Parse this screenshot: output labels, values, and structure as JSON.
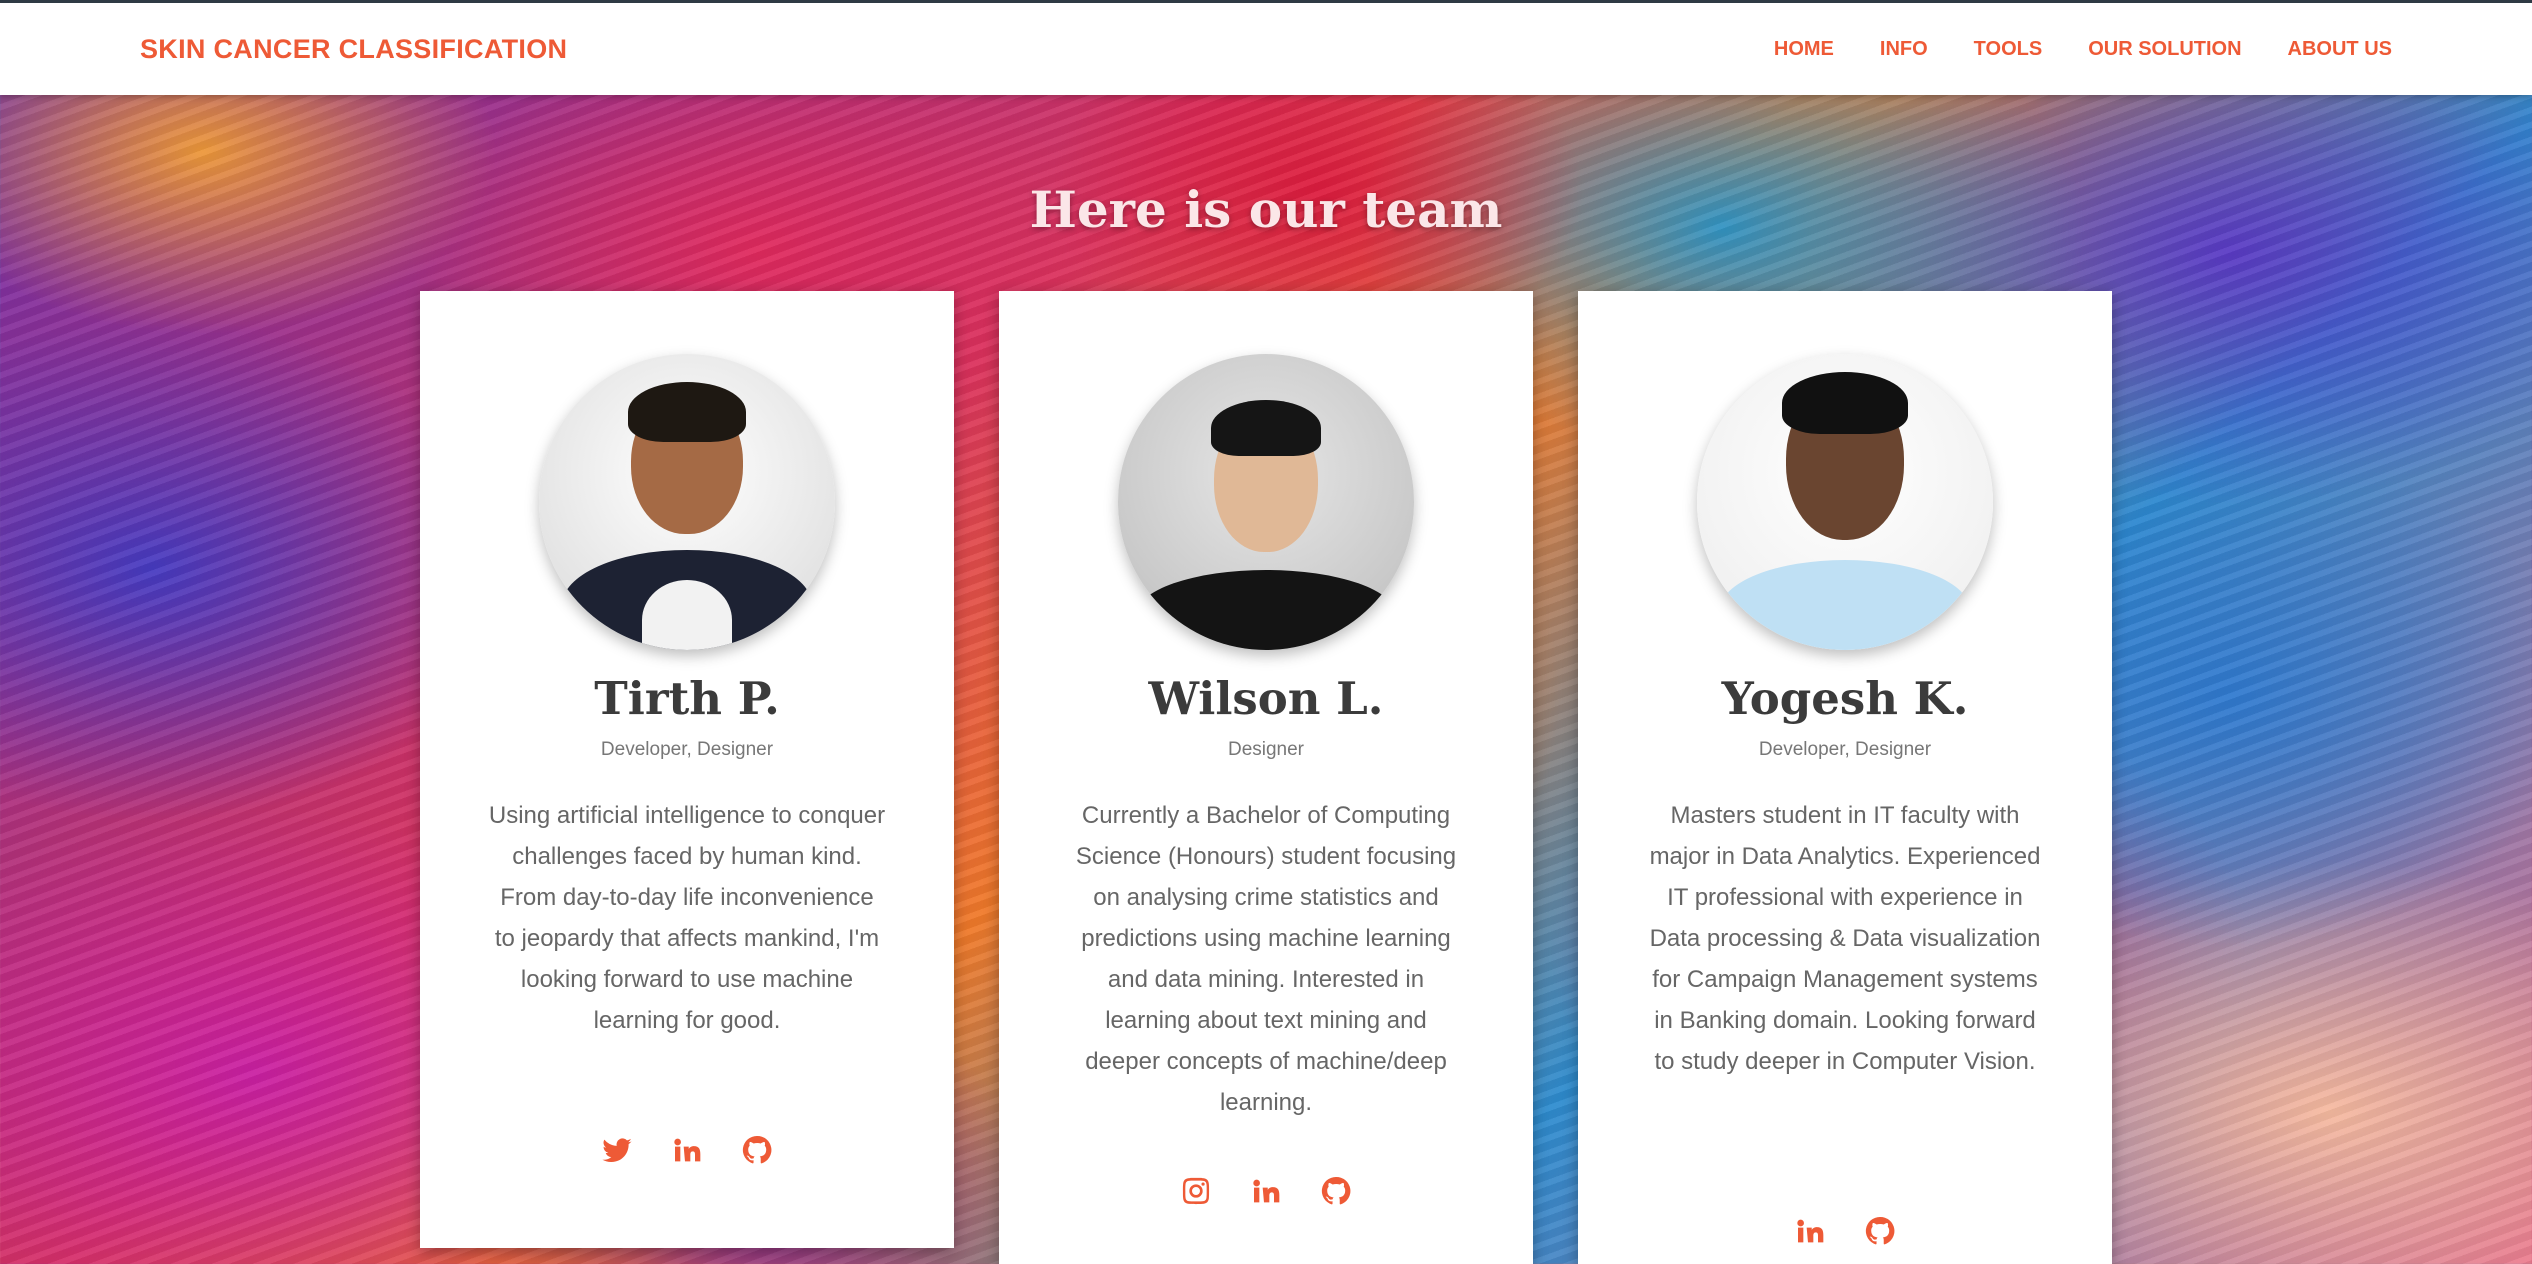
{
  "nav": {
    "brand": "SKIN CANCER CLASSIFICATION",
    "links": [
      "HOME",
      "INFO",
      "TOOLS",
      "OUR SOLUTION",
      "ABOUT US"
    ]
  },
  "section": {
    "title": "Here is our team"
  },
  "team": [
    {
      "name": "Tirth P.",
      "role": "Developer, Designer",
      "bio": "Using artificial intelligence to conquer challenges faced by human kind. From day-to-day life inconvenience to jeopardy that affects mankind, I'm looking forward to use machine learning for good.",
      "socials": [
        "twitter-icon",
        "linkedin-icon",
        "github-icon"
      ]
    },
    {
      "name": "Wilson L.",
      "role": "Designer",
      "bio": "Currently a Bachelor of Computing Science (Honours) student focusing on analysing crime statistics and predictions using machine learning and data mining. Interested in learning about text mining and deeper concepts of machine/deep learning.",
      "socials": [
        "instagram-icon",
        "linkedin-icon",
        "github-icon"
      ]
    },
    {
      "name": "Yogesh K.",
      "role": "Developer, Designer",
      "bio": "Masters student in IT faculty with major in Data Analytics. Experienced IT professional with experience in Data processing & Data visualization for Campaign Management systems in Banking domain. Looking forward to study deeper in Computer Vision.",
      "socials": [
        "linkedin-icon",
        "github-icon"
      ]
    }
  ],
  "colors": {
    "accent": "#ee5a36",
    "navbar_bg": "#ffffff",
    "card_bg": "#ffffff"
  }
}
